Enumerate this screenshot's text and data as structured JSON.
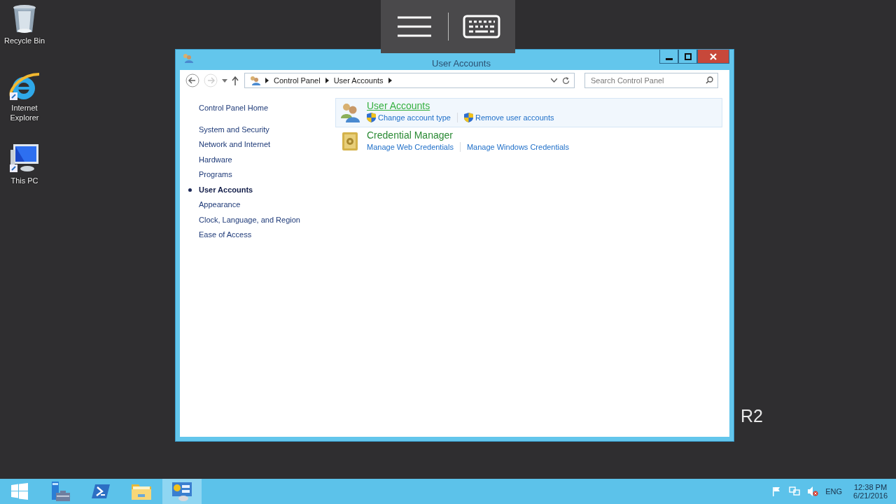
{
  "desktop_icons": [
    {
      "kind": "recycle",
      "label": "Recycle Bin"
    },
    {
      "kind": "browser",
      "label": "Internet Explorer"
    },
    {
      "kind": "computer",
      "label": "This PC"
    }
  ],
  "desktop_text": "R2",
  "window": {
    "title": "User Accounts",
    "breadcrumb": [
      "Control Panel",
      "User Accounts"
    ],
    "search": {
      "placeholder": "Search Control Panel"
    },
    "sidebar": {
      "home": "Control Panel Home",
      "items": [
        {
          "label": "System and Security",
          "selected": false
        },
        {
          "label": "Network and Internet",
          "selected": false
        },
        {
          "label": "Hardware",
          "selected": false
        },
        {
          "label": "Programs",
          "selected": false
        },
        {
          "label": "User Accounts",
          "selected": true
        },
        {
          "label": "Appearance",
          "selected": false
        },
        {
          "label": "Clock, Language, and Region",
          "selected": false
        },
        {
          "label": "Ease of Access",
          "selected": false
        }
      ]
    },
    "categories": [
      {
        "kind": "users",
        "title": "User Accounts",
        "hovered": true,
        "links": [
          {
            "label": "Change account type",
            "shield": true
          },
          {
            "label": "Remove user accounts",
            "shield": true
          }
        ]
      },
      {
        "kind": "vault",
        "title": "Credential Manager",
        "hovered": false,
        "links": [
          {
            "label": "Manage Web Credentials",
            "shield": false
          },
          {
            "label": "Manage Windows Credentials",
            "shield": false
          }
        ]
      }
    ]
  },
  "taskbar": {
    "apps": [
      {
        "kind": "start",
        "selected": false
      },
      {
        "kind": "server",
        "selected": false
      },
      {
        "kind": "shell",
        "selected": false
      },
      {
        "kind": "folder",
        "selected": false
      },
      {
        "kind": "panel",
        "selected": true
      }
    ],
    "language": "ENG",
    "time": "12:38 PM",
    "date": "6/21/2016"
  }
}
